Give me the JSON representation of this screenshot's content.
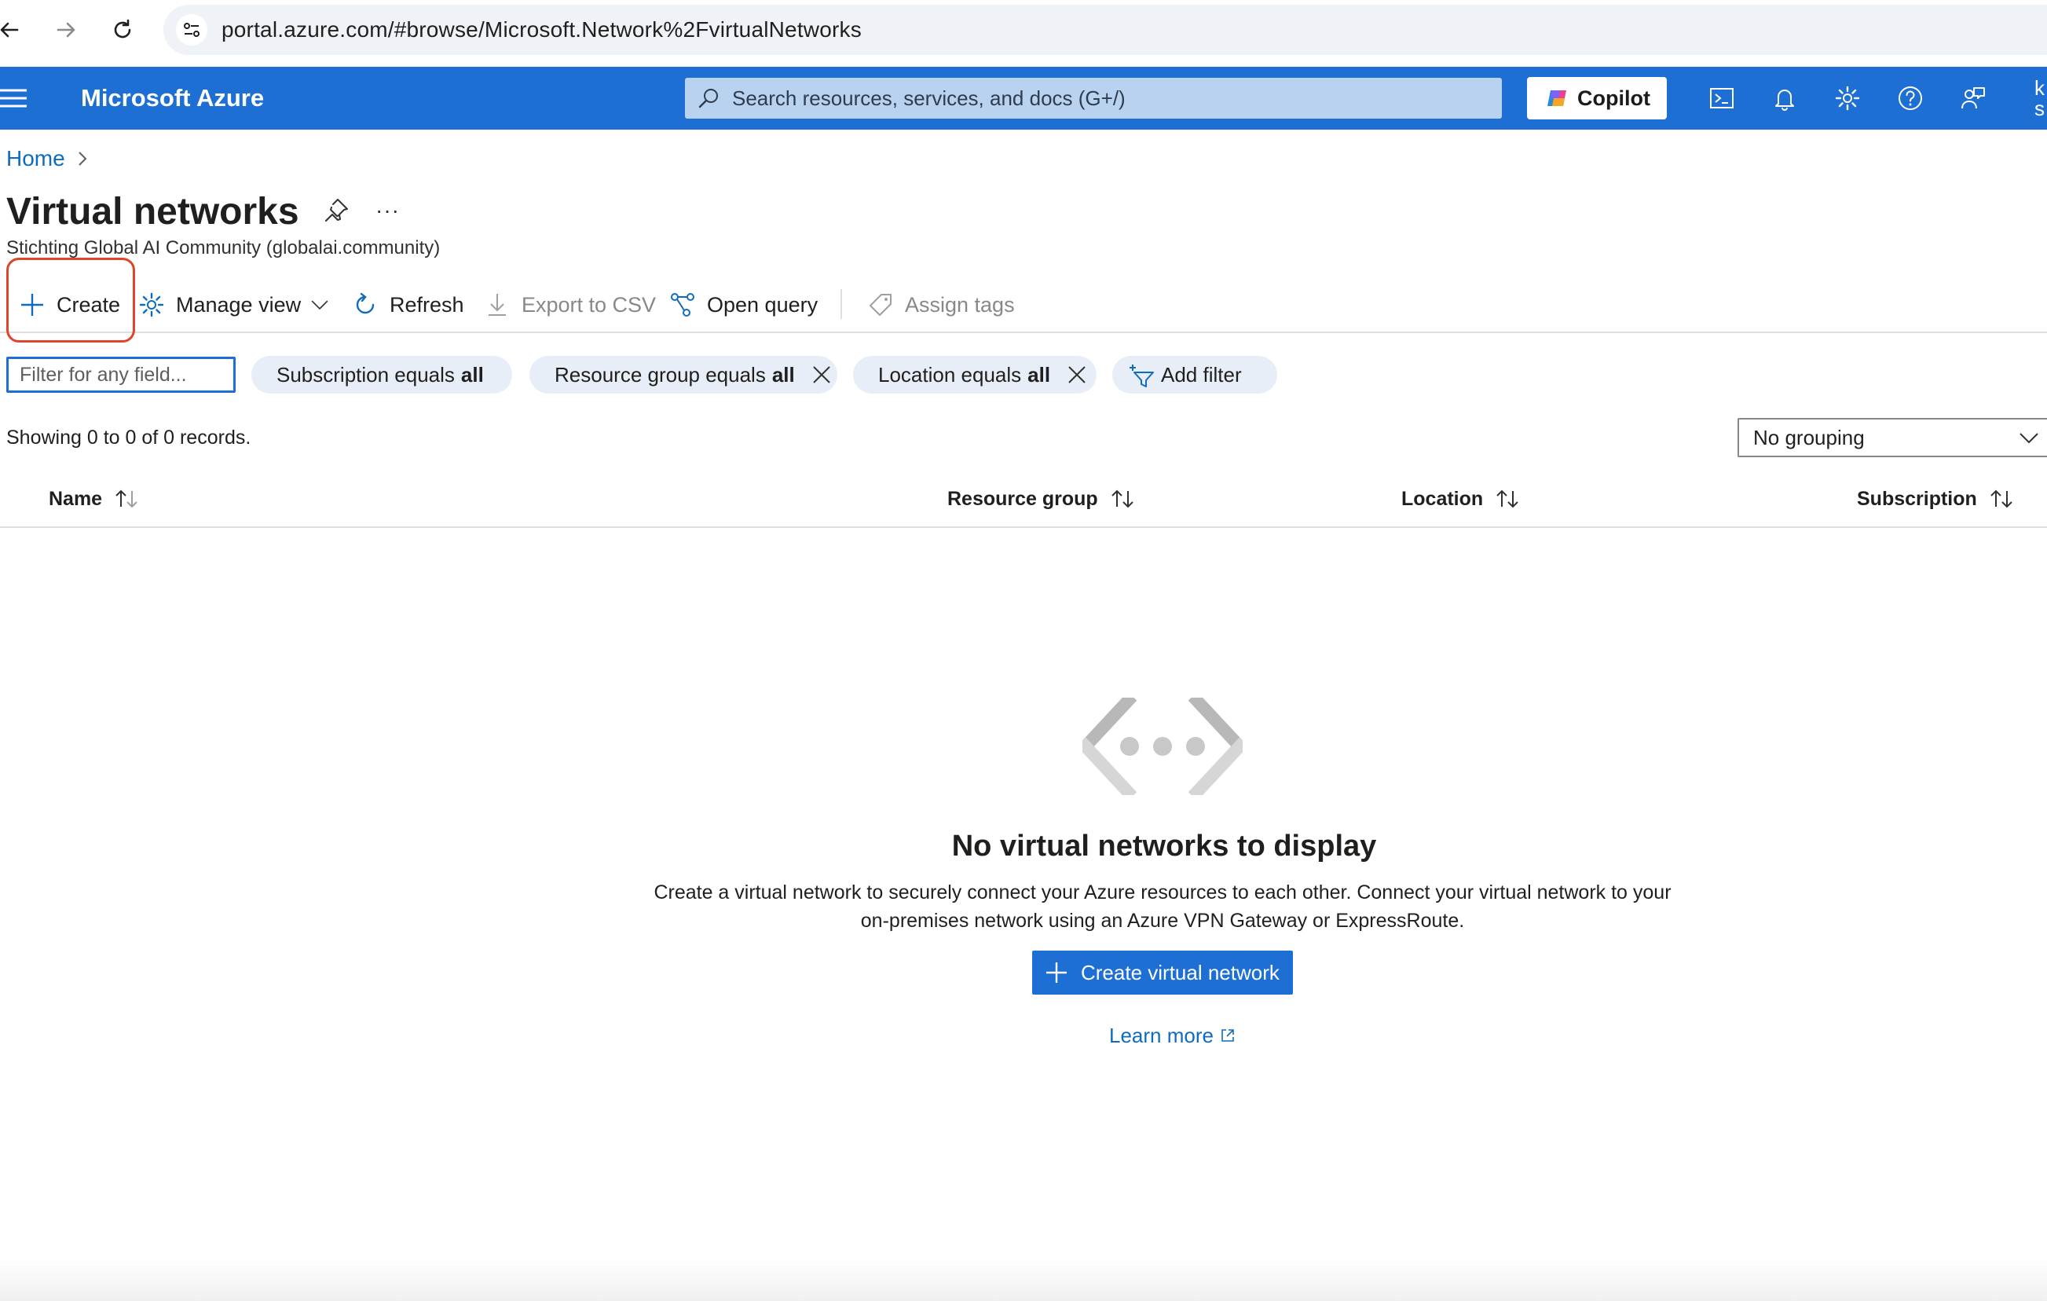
{
  "browser": {
    "url": "portal.azure.com/#browse/Microsoft.Network%2FvirtualNetworks"
  },
  "header": {
    "brand": "Microsoft Azure",
    "search_placeholder": "Search resources, services, and docs (G+/)",
    "copilot_label": "Copilot",
    "account_initials": "k",
    "account_initials_2": "s",
    "accent_color": "#1e6fd3"
  },
  "breadcrumb": {
    "home": "Home"
  },
  "page": {
    "title": "Virtual networks",
    "subtitle": "Stichting Global AI Community (globalai.community)",
    "more": "···"
  },
  "toolbar": {
    "create": "Create",
    "manage_view": "Manage view",
    "refresh": "Refresh",
    "export_csv": "Export to CSV",
    "open_query": "Open query",
    "assign_tags": "Assign tags"
  },
  "filters": {
    "placeholder": "Filter for any field...",
    "subscription_label": "Subscription equals",
    "subscription_value": "all",
    "resource_group_label": "Resource group equals",
    "resource_group_value": "all",
    "location_label": "Location equals",
    "location_value": "all",
    "add_filter": "Add filter"
  },
  "records": {
    "summary": "Showing 0 to 0 of 0 records.",
    "grouping": "No grouping"
  },
  "table": {
    "columns": [
      "Name",
      "Resource group",
      "Location",
      "Subscription"
    ]
  },
  "empty_state": {
    "title": "No virtual networks to display",
    "description_line1": "Create a virtual network to securely connect your Azure resources to each other. Connect your virtual network to your",
    "description_line2": "on-premises network using an Azure VPN Gateway or ExpressRoute.",
    "button": "Create virtual network",
    "learn_more": "Learn more"
  }
}
